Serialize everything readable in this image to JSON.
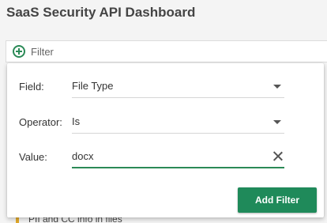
{
  "page": {
    "title": "SaaS Security API Dashboard"
  },
  "filter_bar": {
    "label": "Filter",
    "icon": "plus-circle-icon",
    "accent": "#2b8a57"
  },
  "background_row": {
    "text": "PII and CC info in files"
  },
  "filter_panel": {
    "field": {
      "label": "Field:",
      "value": "File Type"
    },
    "operator": {
      "label": "Operator:",
      "value": "Is"
    },
    "value": {
      "label": "Value:",
      "value": "docx"
    },
    "add_button": {
      "label": "Add Filter",
      "color": "#1f8a5a"
    }
  }
}
